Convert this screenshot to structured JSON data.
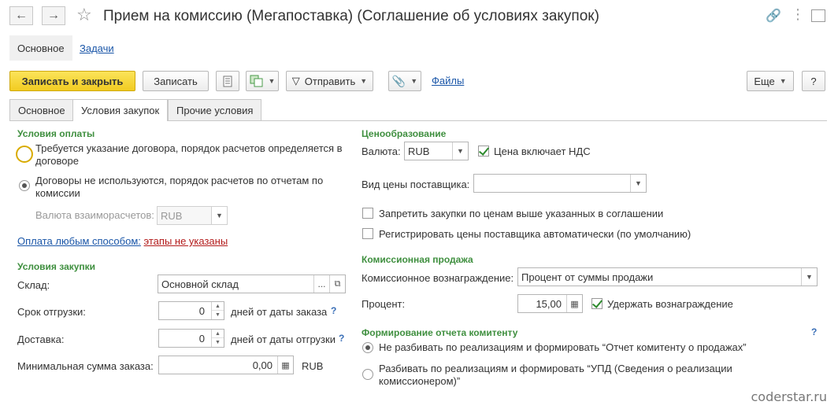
{
  "window": {
    "title": "Прием на комиссию (Мегапоставка) (Соглашение об условиях закупок)"
  },
  "sections": {
    "main": "Основное",
    "tasks": "Задачи"
  },
  "toolbar": {
    "save_close": "Записать и закрыть",
    "save": "Записать",
    "send": "Отправить",
    "files": "Файлы",
    "more": "Еще",
    "help": "?"
  },
  "tabs": [
    "Основное",
    "Условия закупок",
    "Прочие условия"
  ],
  "payment": {
    "title": "Условия оплаты",
    "option1": [
      "Требуется указание договора, порядок расчетов определяется в",
      "договоре"
    ],
    "option2": [
      "Договоры не используются, порядок расчетов по отчетам по",
      "комиссии"
    ],
    "currency_label": "Валюта взаиморасчетов:",
    "currency_value": "RUB",
    "pay_link": "Оплата любым способом:",
    "pay_stages": "этапы не указаны"
  },
  "purchase": {
    "title": "Условия закупки",
    "warehouse_label": "Склад:",
    "warehouse_value": "Основной склад",
    "shipping_label": "Срок отгрузки:",
    "shipping_value": "0",
    "shipping_suffix": "дней от даты заказа",
    "delivery_label": "Доставка:",
    "delivery_value": "0",
    "delivery_suffix": "дней от даты отгрузки",
    "min_sum_label": "Минимальная сумма заказа:",
    "min_sum_value": "0,00",
    "min_sum_currency": "RUB"
  },
  "pricing": {
    "title": "Ценообразование",
    "currency_label": "Валюта:",
    "currency_value": "RUB",
    "vat_label": "Цена включает НДС",
    "price_type_label": "Вид цены поставщика:",
    "price_type_value": "",
    "forbid_label": "Запретить закупки по ценам выше указанных в соглашении",
    "register_label": "Регистрировать цены поставщика автоматически (по умолчанию)"
  },
  "commission": {
    "title": "Комиссионная продажа",
    "fee_label": "Комиссионное вознаграждение:",
    "fee_value": "Процент от суммы продажи",
    "percent_label": "Процент:",
    "percent_value": "15,00",
    "hold_label": "Удержать вознаграждение"
  },
  "report": {
    "title": "Формирование отчета комитенту",
    "option1": "Не разбивать по реализациям и формировать “Отчет комитенту о продажах”",
    "option2": [
      "Разбивать по реализациям и формировать “УПД  (Сведения о реализации",
      "комиссионером)”"
    ]
  },
  "watermark": "coderstar.ru"
}
